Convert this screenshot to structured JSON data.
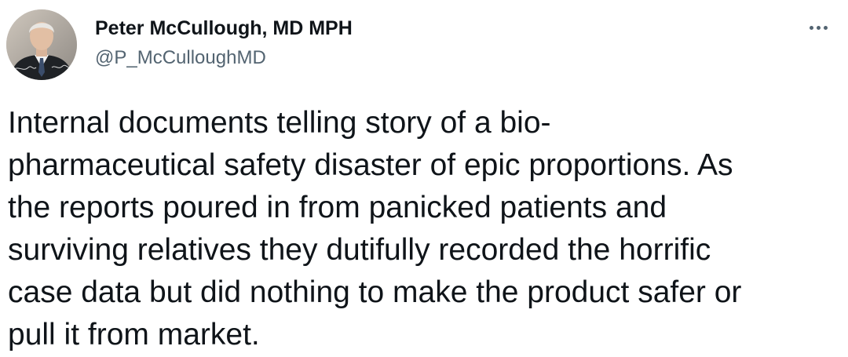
{
  "author": {
    "name": "Peter McCullough, MD MPH",
    "handle": "@P_McCulloughMD"
  },
  "menu": {
    "icon": "more-horizontal-icon"
  },
  "tweet": {
    "text": "Internal documents telling story of a bio-\npharmaceutical safety disaster of epic proportions.  As\nthe reports poured in from panicked patients and\nsurviving relatives they dutifully recorded the horrific\ncase data but did nothing to make the product safer or\npull it from market."
  },
  "colors": {
    "text": "#0f1419",
    "secondary": "#536471",
    "background": "#ffffff"
  }
}
